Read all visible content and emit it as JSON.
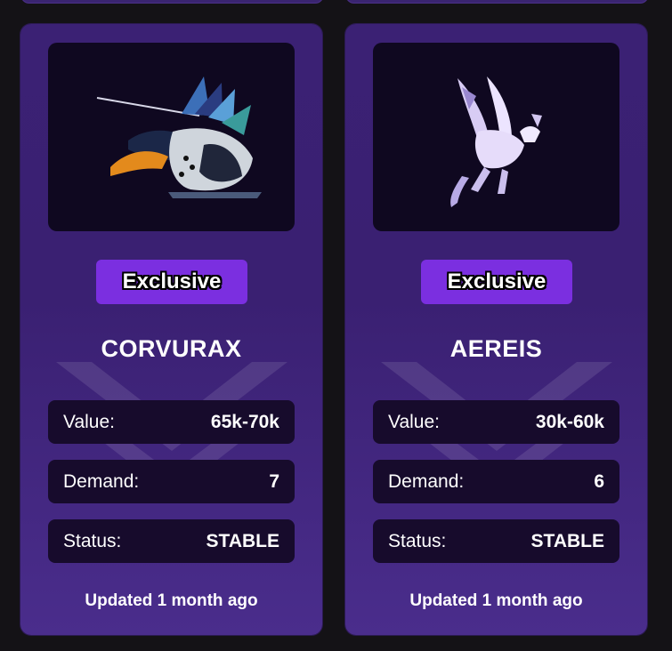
{
  "cards": [
    {
      "badge": "Exclusive",
      "name": "CORVURAX",
      "value_label": "Value:",
      "value": "65k-70k",
      "demand_label": "Demand:",
      "demand": "7",
      "status_label": "Status:",
      "status": "STABLE",
      "updated": "Updated 1 month ago"
    },
    {
      "badge": "Exclusive",
      "name": "AEREIS",
      "value_label": "Value:",
      "value": "30k-60k",
      "demand_label": "Demand:",
      "demand": "6",
      "status_label": "Status:",
      "status": "STABLE",
      "updated": "Updated 1 month ago"
    }
  ],
  "colors": {
    "page_bg": "#141216",
    "card_bg": "#3b2174",
    "badge_bg": "#7b2fe0",
    "stat_bg": "#170b2c",
    "image_bg": "#0f0820"
  }
}
